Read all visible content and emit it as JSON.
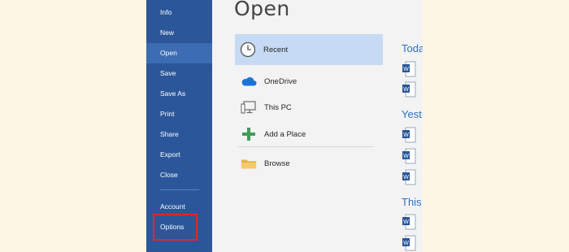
{
  "sidebar": {
    "items": [
      {
        "label": "Info"
      },
      {
        "label": "New"
      },
      {
        "label": "Open"
      },
      {
        "label": "Save"
      },
      {
        "label": "Save As"
      },
      {
        "label": "Print"
      },
      {
        "label": "Share"
      },
      {
        "label": "Export"
      },
      {
        "label": "Close"
      },
      {
        "label": "Account"
      },
      {
        "label": "Options"
      }
    ],
    "active": "Open",
    "highlighted": "Options",
    "highlight_color": "#e0262b"
  },
  "main": {
    "title": "Open",
    "locations": [
      {
        "label": "Recent",
        "icon": "clock-icon",
        "selected": true
      },
      {
        "label": "OneDrive",
        "icon": "cloud-icon"
      },
      {
        "label": "This PC",
        "icon": "computer-icon"
      },
      {
        "label": "Add a Place",
        "icon": "plus-icon"
      },
      {
        "label": "Browse",
        "icon": "folder-icon"
      }
    ],
    "recent_groups": [
      {
        "label": "Toda"
      },
      {
        "label": "Yest"
      },
      {
        "label": "This"
      }
    ]
  },
  "colors": {
    "sidebar_bg": "#2b579a",
    "selected_location": "#c6daf3",
    "group_heading": "#2b72c2",
    "page_bg": "#fdf8e4"
  }
}
